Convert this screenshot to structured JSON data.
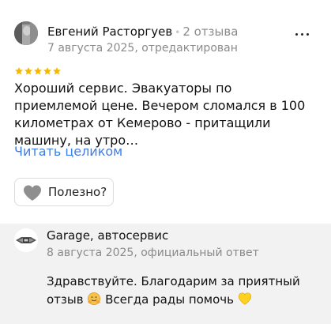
{
  "review": {
    "author_name": "Евгений Расторгуев",
    "separator": "•",
    "reviews_count": "2 отзыва",
    "date": "7 августа 2025, отредактирован",
    "rating": 5,
    "star_color": "#f5b800",
    "text": "Хороший сервис. Эвакуаторы по приемлемой цене. Вечером сломался в 100 километрах от Кемерово - притащили машину, на утро…",
    "read_more": "Читать целиком",
    "helpful_label": "Полезно?",
    "helpful_icon": "heart-icon",
    "link_color": "#3d7ee6"
  },
  "reply": {
    "business_name": "Garage, автосервис",
    "date": "8 августа 2025, официальный ответ",
    "text_part1": "Здравствуйте. Благодарим за приятный отзыв",
    "text_part2": "Всегда рады помочь",
    "emoji_1": "hugging-face-emoji",
    "emoji_2": "yellow-heart-emoji"
  }
}
